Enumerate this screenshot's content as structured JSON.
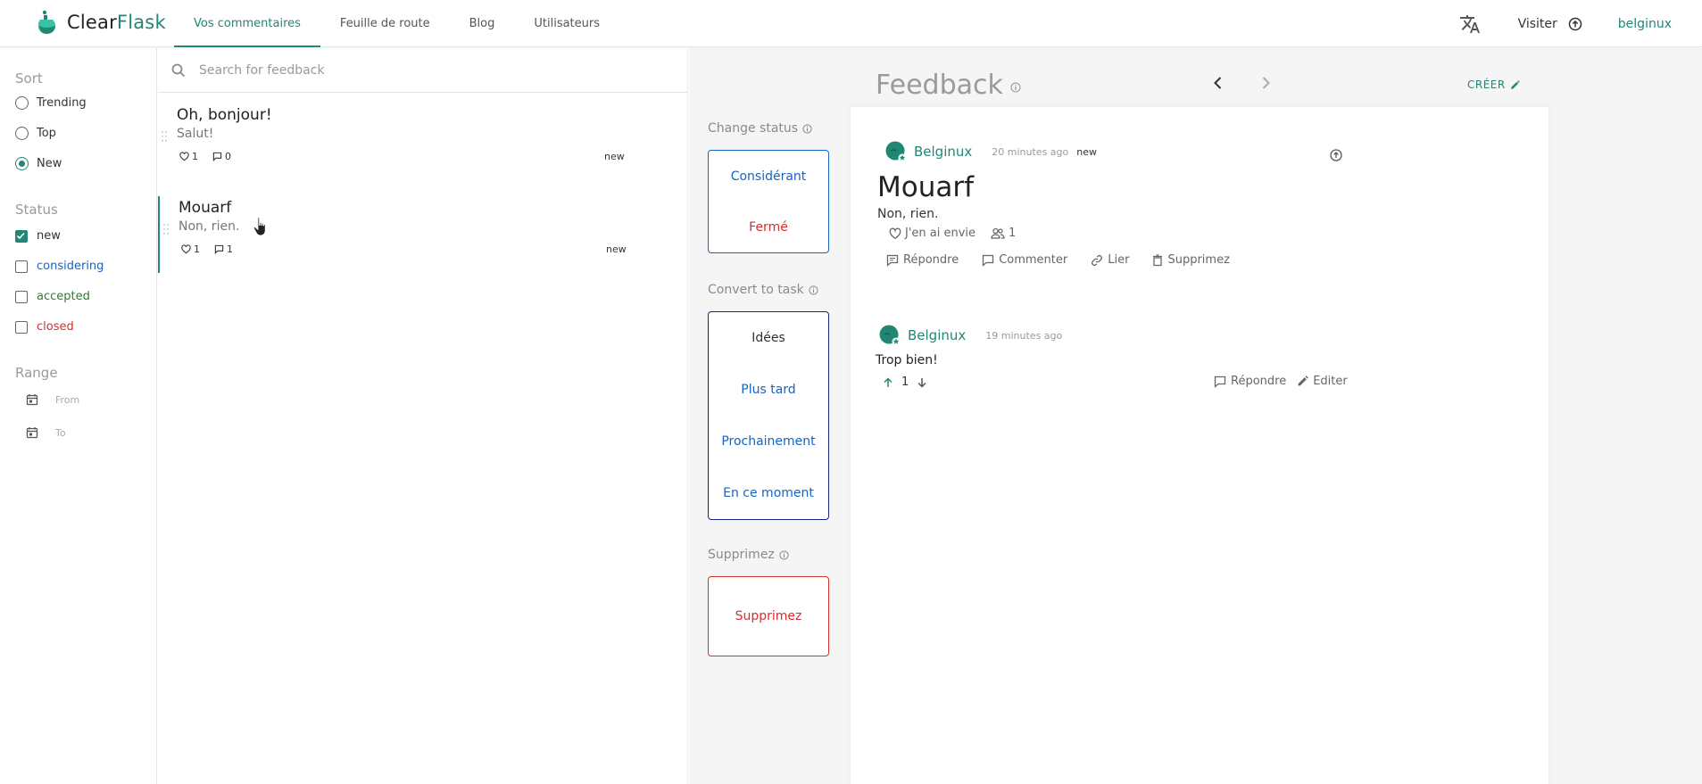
{
  "app": {
    "logo": {
      "part1": "Clear",
      "part2": "Flask"
    },
    "nav": [
      {
        "label": "Vos commentaires",
        "active": true
      },
      {
        "label": "Feuille de route"
      },
      {
        "label": "Blog"
      },
      {
        "label": "Utilisateurs"
      }
    ],
    "visit_label": "Visiter",
    "user_label": "belginux",
    "accent": "#218774"
  },
  "filters": {
    "sort_title": "Sort",
    "sort_options": [
      "Trending",
      "Top",
      "New"
    ],
    "sort_selected": "New",
    "status_title": "Status",
    "status_options": [
      {
        "label": "new",
        "color": "#333333",
        "checked": true
      },
      {
        "label": "considering",
        "color": "#1565c0",
        "checked": false
      },
      {
        "label": "accepted",
        "color": "#2e7d32",
        "checked": false
      },
      {
        "label": "closed",
        "color": "#d32f2f",
        "checked": false
      }
    ],
    "range_title": "Range",
    "range_from": "From",
    "range_to": "To"
  },
  "list": {
    "search_placeholder": "Search for feedback",
    "posts": [
      {
        "title": "Oh, bonjour!",
        "desc": "Salut!",
        "likes": "1",
        "comments": "0",
        "status": "new"
      },
      {
        "title": "Mouarf",
        "desc": "Non, rien.",
        "likes": "1",
        "comments": "1",
        "status": "new"
      }
    ]
  },
  "actions": {
    "change_status_title": "Change status",
    "change_status": [
      "Considérant",
      "Fermé"
    ],
    "convert_title": "Convert to task",
    "convert": [
      "Idées",
      "Plus tard",
      "Prochainement",
      "En ce moment"
    ],
    "delete_title": "Supprimez",
    "delete_button": "Supprimez"
  },
  "detail": {
    "heading": "Feedback",
    "create_label": "CRÉER",
    "post": {
      "author": "Belginux",
      "time": "20 minutes ago",
      "status": "new",
      "title": "Mouarf",
      "desc": "Non, rien.",
      "fund_label": "J'en ai envie",
      "voters": "1",
      "actions": [
        "Répondre",
        "Commenter",
        "Lier",
        "Supprimez"
      ]
    },
    "comment": {
      "author": "Belginux",
      "time": "19 minutes ago",
      "text": "Trop bien!",
      "votes": "1",
      "reply_label": "Répondre",
      "edit_label": "Editer"
    }
  }
}
